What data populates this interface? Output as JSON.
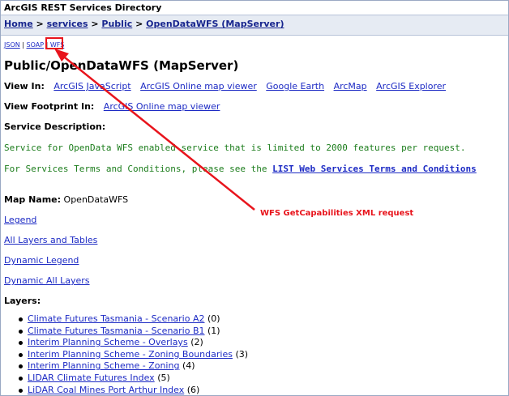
{
  "window_title": "ArcGIS REST Services Directory",
  "breadcrumb": [
    "Home",
    "services",
    "Public",
    "OpenDataWFS (MapServer)"
  ],
  "breadcrumb_sep": ">",
  "formats": [
    "JSON",
    "SOAP",
    "WFS"
  ],
  "format_sep": "|",
  "page_title": "Public/OpenDataWFS (MapServer)",
  "view_in": {
    "label": "View In:",
    "links": [
      "ArcGIS JavaScript",
      "ArcGIS Online map viewer",
      "Google Earth",
      "ArcMap",
      "ArcGIS Explorer"
    ]
  },
  "view_footprint": {
    "label": "View Footprint In:",
    "link": "ArcGIS Online map viewer"
  },
  "service_description_label": "Service Description:",
  "description_line1": "Service for OpenData WFS enabled service that is limited to 2000 features per request.",
  "description_line2_prefix": "For Services Terms and Conditions, please see the",
  "description_line2_link": "LIST Web Services Terms and Conditions",
  "map_name": {
    "label": "Map Name:",
    "value": "OpenDataWFS"
  },
  "links": [
    "Legend",
    "All Layers and Tables",
    "Dynamic Legend",
    "Dynamic All Layers"
  ],
  "layers_label": "Layers:",
  "layers": [
    {
      "name": "Climate Futures Tasmania - Scenario A2",
      "id": "(0)"
    },
    {
      "name": "Climate Futures Tasmania - Scenario B1",
      "id": "(1)"
    },
    {
      "name": "Interim Planning Scheme - Overlays",
      "id": "(2)"
    },
    {
      "name": "Interim Planning Scheme - Zoning Boundaries",
      "id": "(3)"
    },
    {
      "name": "Interim Planning Scheme - Zoning",
      "id": "(4)"
    },
    {
      "name": "LIDAR Climate Futures Index",
      "id": "(5)"
    },
    {
      "name": "LiDAR Coal Mines Port Arthur Index",
      "id": "(6)"
    }
  ],
  "annotation": "WFS GetCapabilities XML request",
  "colors": {
    "annotation": "#e8141c",
    "link": "#1c2ac4",
    "description": "#1c7d1c",
    "nav_bg": "#e6ebf3"
  }
}
